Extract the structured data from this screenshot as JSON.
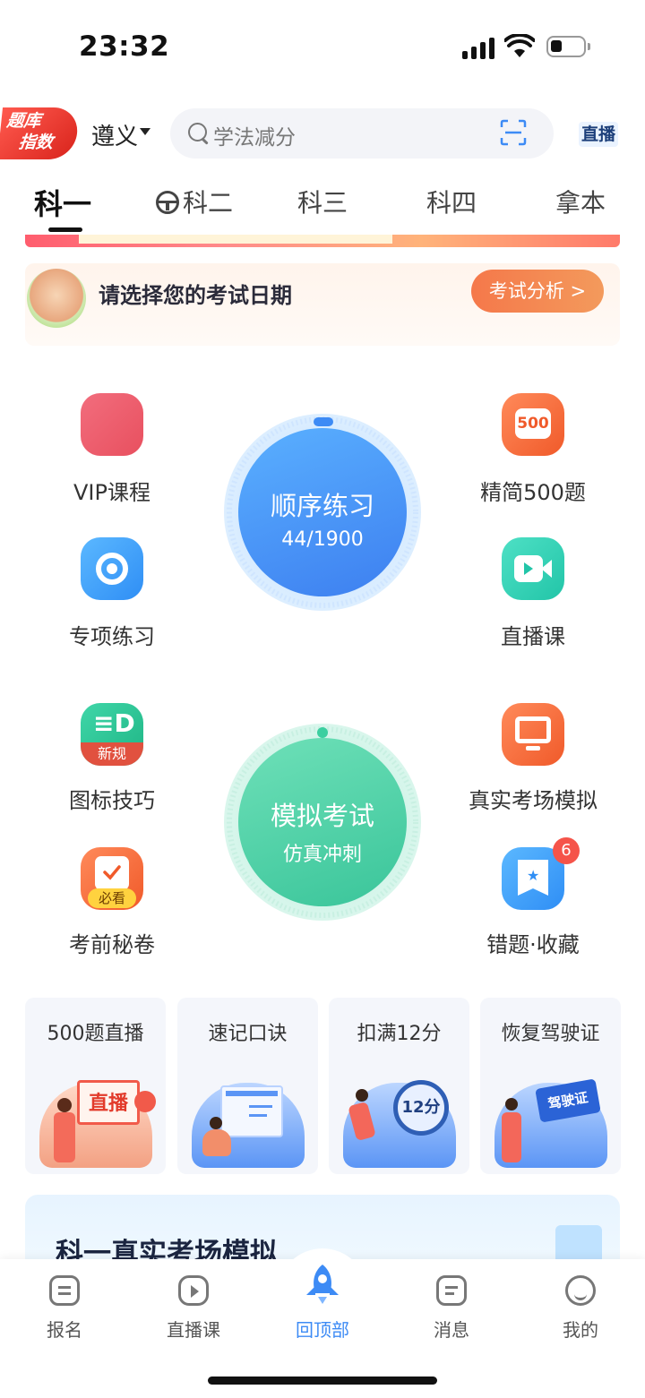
{
  "status_bar": {
    "time": "23:32"
  },
  "header": {
    "logo_line1": "题库",
    "logo_line2": "指数",
    "city": "遵义",
    "search_placeholder": "学法减分",
    "live_tag": "直播"
  },
  "tabs": [
    {
      "label": "科一",
      "active": true
    },
    {
      "label": "科二",
      "active": false
    },
    {
      "label": "科三",
      "active": false
    },
    {
      "label": "科四",
      "active": false
    },
    {
      "label": "拿本",
      "active": false
    }
  ],
  "exam_date": {
    "text": "请选择您的考试日期",
    "button": "考试分析 >"
  },
  "features": {
    "vip": "VIP课程",
    "jingjian": "精简500题",
    "jingjian_badge": "500",
    "zhuanxiang": "专项练习",
    "zhibo": "直播课",
    "tubiao": "图标技巧",
    "tubiao_badge": "新规",
    "zhenshi": "真实考场模拟",
    "kaoqian": "考前秘卷",
    "kaoqian_badge": "必看",
    "cuoti": "错题·收藏",
    "cuoti_count": "6"
  },
  "practice_circle": {
    "title": "顺序练习",
    "progress": "44/1900",
    "done": 44,
    "total": 1900
  },
  "exam_circle": {
    "title": "模拟考试",
    "subtitle": "仿真冲刺"
  },
  "cards": [
    {
      "title": "500题直播",
      "art_text": "直播"
    },
    {
      "title": "速记口诀",
      "art_text": ""
    },
    {
      "title": "扣满12分",
      "art_text": "12分"
    },
    {
      "title": "恢复驾驶证",
      "art_text": "驾驶证"
    }
  ],
  "sim_card": {
    "title": "科一真实考场模拟"
  },
  "bottom_nav": [
    {
      "label": "报名",
      "active": false
    },
    {
      "label": "直播课",
      "active": false
    },
    {
      "label": "回顶部",
      "active": true
    },
    {
      "label": "消息",
      "active": false
    },
    {
      "label": "我的",
      "active": false
    }
  ],
  "colors": {
    "brand_blue": "#3d8bf5",
    "green": "#3ccfa0",
    "orange": "#f5784a",
    "red": "#f5544a"
  }
}
